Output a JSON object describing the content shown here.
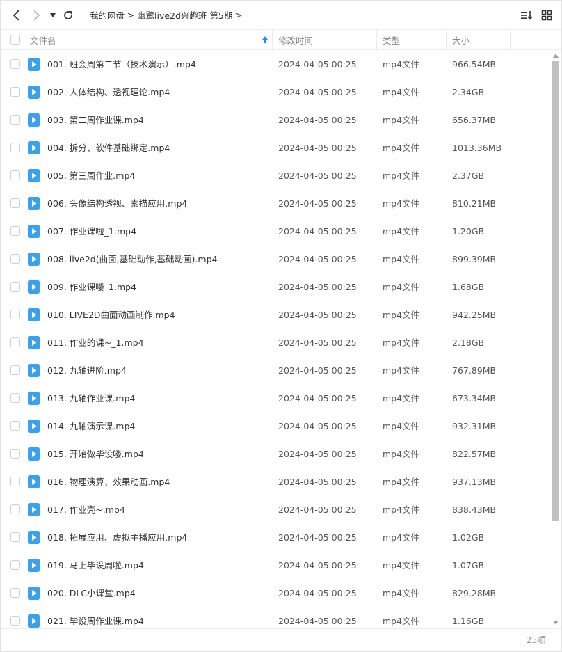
{
  "toolbar": {
    "breadcrumb": [
      "我的网盘",
      "幽鹭live2d兴趣班 第5期"
    ],
    "separator": ">"
  },
  "columns": {
    "name": "文件名",
    "modified": "修改时间",
    "type": "类型",
    "size": "大小"
  },
  "colors": {
    "file_icon": "#3aa0f0",
    "sort_arrow": "#2a8cf0"
  },
  "files": [
    {
      "name": "001.  班会周第二节（技术演示）.mp4",
      "modified": "2024-04-05 00:25",
      "type": "mp4文件",
      "size": "966.54MB"
    },
    {
      "name": "002.  人体结构、透视理论.mp4",
      "modified": "2024-04-05 00:25",
      "type": "mp4文件",
      "size": "2.34GB"
    },
    {
      "name": "003.  第二周作业课.mp4",
      "modified": "2024-04-05 00:25",
      "type": "mp4文件",
      "size": "656.37MB"
    },
    {
      "name": "004.  拆分、软件基础绑定.mp4",
      "modified": "2024-04-05 00:25",
      "type": "mp4文件",
      "size": "1013.36MB"
    },
    {
      "name": "005.  第三周作业.mp4",
      "modified": "2024-04-05 00:25",
      "type": "mp4文件",
      "size": "2.37GB"
    },
    {
      "name": "006.  头像结构透视、素描应用.mp4",
      "modified": "2024-04-05 00:25",
      "type": "mp4文件",
      "size": "810.21MB"
    },
    {
      "name": "007.  作业课啦_1.mp4",
      "modified": "2024-04-05 00:25",
      "type": "mp4文件",
      "size": "1.20GB"
    },
    {
      "name": "008.  live2d(曲面,基础动作,基础动画).mp4",
      "modified": "2024-04-05 00:25",
      "type": "mp4文件",
      "size": "899.39MB"
    },
    {
      "name": "009.  作业课喽_1.mp4",
      "modified": "2024-04-05 00:25",
      "type": "mp4文件",
      "size": "1.68GB"
    },
    {
      "name": "010.  LIVE2D曲面动画制作.mp4",
      "modified": "2024-04-05 00:25",
      "type": "mp4文件",
      "size": "942.25MB"
    },
    {
      "name": "011.  作业的课~_1.mp4",
      "modified": "2024-04-05 00:25",
      "type": "mp4文件",
      "size": "2.18GB"
    },
    {
      "name": "012.  九轴进阶.mp4",
      "modified": "2024-04-05 00:25",
      "type": "mp4文件",
      "size": "767.89MB"
    },
    {
      "name": "013.  九轴作业课.mp4",
      "modified": "2024-04-05 00:25",
      "type": "mp4文件",
      "size": "673.34MB"
    },
    {
      "name": "014.  九轴演示课.mp4",
      "modified": "2024-04-05 00:25",
      "type": "mp4文件",
      "size": "932.31MB"
    },
    {
      "name": "015.  开始做毕设喽.mp4",
      "modified": "2024-04-05 00:25",
      "type": "mp4文件",
      "size": "822.57MB"
    },
    {
      "name": "016.  物理演算、效果动画.mp4",
      "modified": "2024-04-05 00:25",
      "type": "mp4文件",
      "size": "937.13MB"
    },
    {
      "name": "017.  作业壳~.mp4",
      "modified": "2024-04-05 00:25",
      "type": "mp4文件",
      "size": "838.43MB"
    },
    {
      "name": "018.  拓展应用、虚拟主播应用.mp4",
      "modified": "2024-04-05 00:25",
      "type": "mp4文件",
      "size": "1.02GB"
    },
    {
      "name": "019.  马上毕设周啦.mp4",
      "modified": "2024-04-05 00:25",
      "type": "mp4文件",
      "size": "1.07GB"
    },
    {
      "name": "020.  DLC小课堂.mp4",
      "modified": "2024-04-05 00:25",
      "type": "mp4文件",
      "size": "829.28MB"
    },
    {
      "name": "021.  毕设周作业课.mp4",
      "modified": "2024-04-05 00:25",
      "type": "mp4文件",
      "size": "1.16GB"
    }
  ],
  "status": {
    "count": "25项"
  }
}
